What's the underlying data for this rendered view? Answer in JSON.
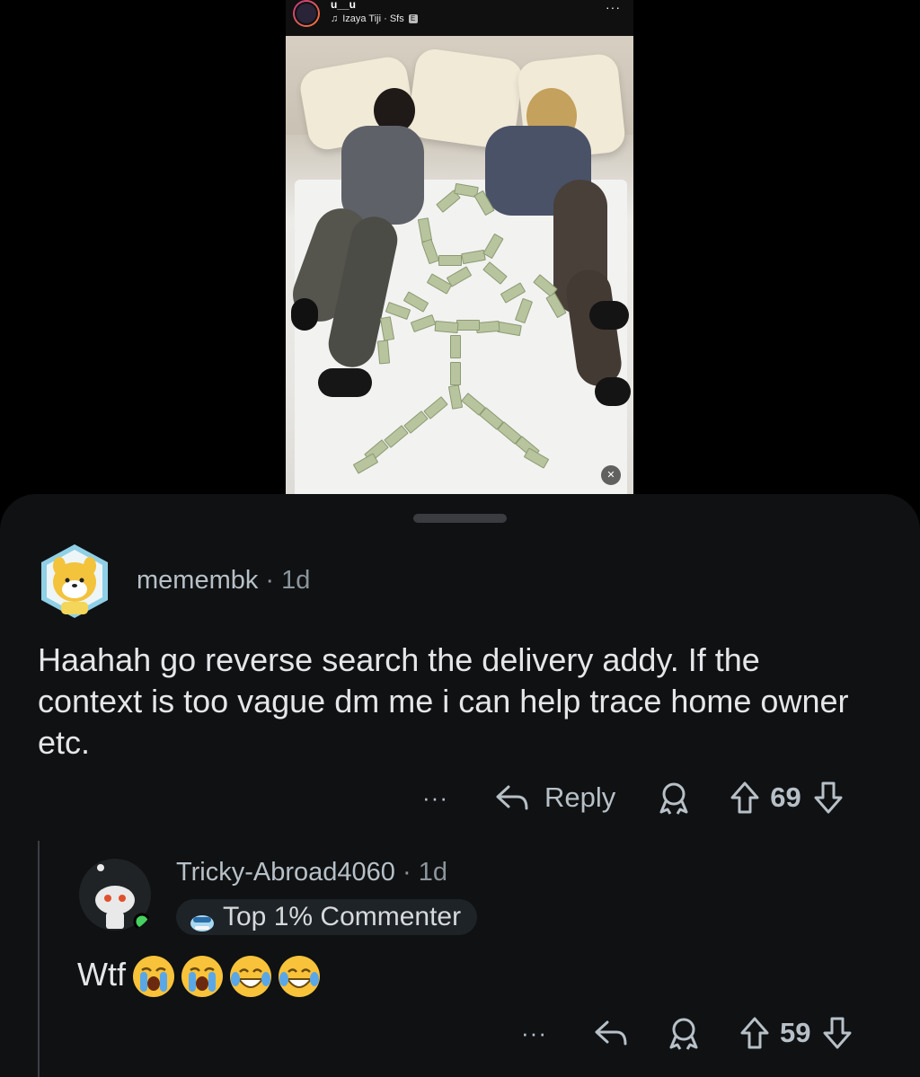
{
  "story": {
    "username": "u__u",
    "music": "Izaya Tiji · Sfs",
    "music_badge": "E",
    "more": "···"
  },
  "comments": [
    {
      "username": "memembk",
      "time": "1d",
      "body": "Haahah go reverse search the delivery addy. If the context is too vague dm me i can help trace home owner etc.",
      "more": "···",
      "reply_label": "Reply",
      "votes": "69"
    },
    {
      "username": "Tricky-Abroad4060",
      "time": "1d",
      "badge": "Top 1% Commenter",
      "body": "Wtf",
      "emojis": [
        "loudly-crying-face",
        "loudly-crying-face",
        "face-with-tears-of-joy",
        "face-with-tears-of-joy"
      ],
      "more": "···",
      "votes": "59",
      "online": true
    }
  ],
  "colors": {
    "background": "#000000",
    "sheet": "#0f1113",
    "text_primary": "#e4e6e8",
    "text_meta": "#8c959c",
    "online": "#46d160"
  }
}
